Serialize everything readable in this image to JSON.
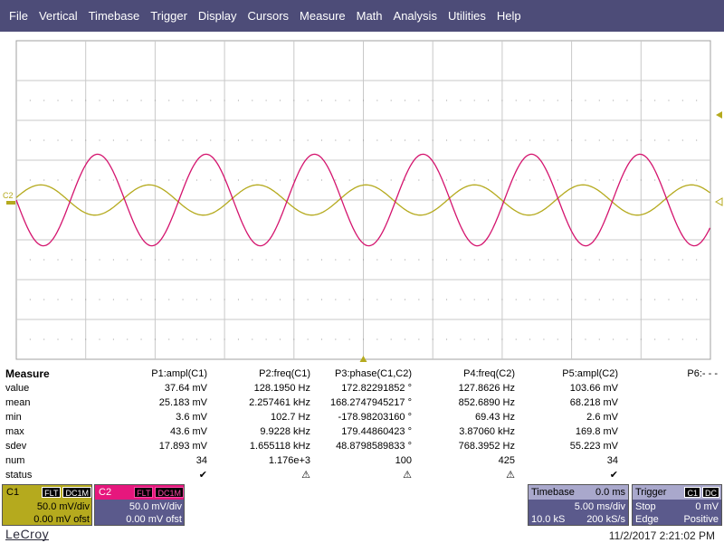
{
  "menu": [
    "File",
    "Vertical",
    "Timebase",
    "Trigger",
    "Display",
    "Cursors",
    "Measure",
    "Math",
    "Analysis",
    "Utilities",
    "Help"
  ],
  "colors": {
    "menubar": "#4d4c78",
    "c1_trace": "#b5aa1e",
    "c2_trace": "#d4146e",
    "grid": "#a0a0a0",
    "panel_bg": "#5b5a8c"
  },
  "grid": {
    "h_divisions": 10,
    "v_divisions": 8
  },
  "markers": {
    "c2_label": "C2",
    "trigger_icon": "trigger-level-arrow-icon"
  },
  "traces": {
    "c1": {
      "cycles_visible": 6.4,
      "relative_amplitude": 0.33
    },
    "c2": {
      "cycles_visible": 6.4,
      "relative_amplitude": 1.0
    }
  },
  "measure": {
    "title": "Measure",
    "headers": [
      "P1:ampl(C1)",
      "P2:freq(C1)",
      "P3:phase(C1,C2)",
      "P4:freq(C2)",
      "P5:ampl(C2)",
      "P6:- - -"
    ],
    "rows": [
      {
        "label": "value",
        "cells": [
          "37.64 mV",
          "128.1950 Hz",
          "172.82291852 °",
          "127.8626 Hz",
          "103.66 mV",
          ""
        ]
      },
      {
        "label": "mean",
        "cells": [
          "25.183 mV",
          "2.257461 kHz",
          "168.2747945217 °",
          "852.6890 Hz",
          "68.218 mV",
          ""
        ]
      },
      {
        "label": "min",
        "cells": [
          "3.6 mV",
          "102.7 Hz",
          "-178.98203160 °",
          "69.43 Hz",
          "2.6 mV",
          ""
        ]
      },
      {
        "label": "max",
        "cells": [
          "43.6 mV",
          "9.9228 kHz",
          "179.44860423 °",
          "3.87060 kHz",
          "169.8 mV",
          ""
        ]
      },
      {
        "label": "sdev",
        "cells": [
          "17.893 mV",
          "1.655118 kHz",
          "48.8798589833 °",
          "768.3952 Hz",
          "55.223 mV",
          ""
        ]
      },
      {
        "label": "num",
        "cells": [
          "34",
          "1.176e+3",
          "100",
          "425",
          "34",
          ""
        ]
      },
      {
        "label": "status",
        "cells": [
          "✔",
          "⚠",
          "⚠",
          "⚠",
          "✔",
          ""
        ]
      }
    ]
  },
  "c1": {
    "label": "C1",
    "badges": [
      "FLT",
      "DC1M"
    ],
    "vdiv": "50.0 mV/div",
    "offset": "0.00 mV ofst"
  },
  "c2": {
    "label": "C2",
    "badges": [
      "FLT",
      "DC1M"
    ],
    "vdiv": "50.0 mV/div",
    "offset": "0.00 mV ofst"
  },
  "timebase": {
    "label": "Timebase",
    "delay": "0.0 ms",
    "tdiv": "5.00 ms/div",
    "samples": "10.0 kS",
    "rate": "200 kS/s"
  },
  "trigger": {
    "label": "Trigger",
    "badges": [
      "C1",
      "DC"
    ],
    "mode": "Stop",
    "level": "0 mV",
    "type": "Edge",
    "slope": "Positive"
  },
  "brand": "LeCroy",
  "datetime": "11/2/2017 2:21:02 PM"
}
